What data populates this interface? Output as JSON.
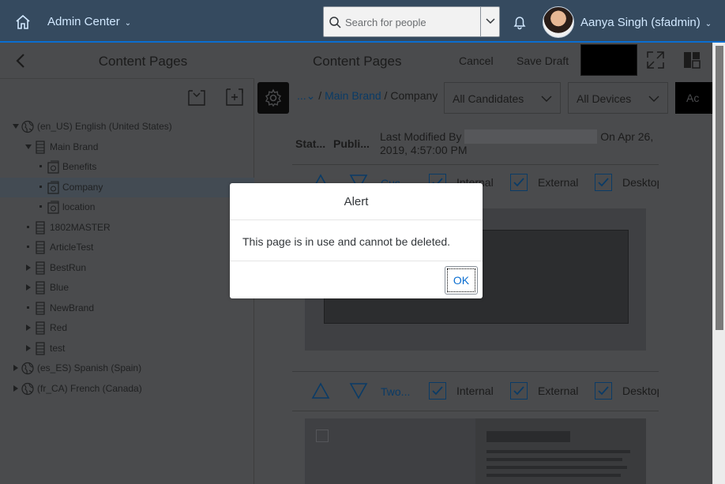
{
  "shell": {
    "app_title": "Admin Center",
    "search_placeholder": "Search for people",
    "user_name": "Aanya Singh (sfadmin)"
  },
  "left_pane": {
    "title": "Content Pages",
    "tree": [
      {
        "label": "(en_US) English (United States)",
        "level": 0,
        "expander": "expanded",
        "icon": "globe-icon"
      },
      {
        "label": "Main Brand",
        "level": 1,
        "expander": "expanded",
        "icon": "site-icon"
      },
      {
        "label": "Benefits",
        "level": 2,
        "expander": "none",
        "icon": "page-icon"
      },
      {
        "label": "Company",
        "level": 2,
        "expander": "none",
        "icon": "page-icon",
        "selected": true
      },
      {
        "label": "location",
        "level": 2,
        "expander": "none",
        "icon": "page-icon"
      },
      {
        "label": "1802MASTER",
        "level": 1,
        "expander": "none",
        "icon": "site-icon"
      },
      {
        "label": "ArticleTest",
        "level": 1,
        "expander": "none",
        "icon": "site-icon"
      },
      {
        "label": "BestRun",
        "level": 1,
        "expander": "collapsed",
        "icon": "site-icon"
      },
      {
        "label": "Blue",
        "level": 1,
        "expander": "collapsed",
        "icon": "site-icon"
      },
      {
        "label": "NewBrand",
        "level": 1,
        "expander": "none",
        "icon": "site-icon"
      },
      {
        "label": "Red",
        "level": 1,
        "expander": "collapsed",
        "icon": "site-icon"
      },
      {
        "label": "test",
        "level": 1,
        "expander": "collapsed",
        "icon": "site-icon"
      },
      {
        "label": "(es_ES) Spanish (Spain)",
        "level": 0,
        "expander": "collapsed",
        "icon": "globe-icon"
      },
      {
        "label": "(fr_CA) French (Canada)",
        "level": 0,
        "expander": "collapsed",
        "icon": "globe-icon"
      }
    ]
  },
  "right_pane": {
    "title": "Content Pages",
    "cancel_label": "Cancel",
    "save_draft_label": "Save Draft",
    "breadcrumb": {
      "ellipsis": "...",
      "separator": " / ",
      "link": "Main Brand",
      "current": "Company"
    },
    "candidates_select": "All Candidates",
    "devices_select": "All Devices",
    "action_button": "Ac",
    "columns": {
      "status": "Stat...",
      "published": "Publi...",
      "modified_prefix": "Last Modified By",
      "modified_suffix": "On Apr 26,",
      "modified_line2": "2019, 4:57:00 PM"
    },
    "rows": [
      {
        "name": "Cus...",
        "internal": "Internal",
        "external": "External",
        "desktop": "Desktop"
      },
      {
        "name": "Two...",
        "internal": "Internal",
        "external": "External",
        "desktop": "Desktop"
      }
    ]
  },
  "dialog": {
    "title": "Alert",
    "message": "This page is in use and cannot be deleted.",
    "ok_label": "OK"
  },
  "colors": {
    "shell_bg": "#354a5f",
    "accent": "#0a6ed1",
    "link": "#0a3b66"
  }
}
